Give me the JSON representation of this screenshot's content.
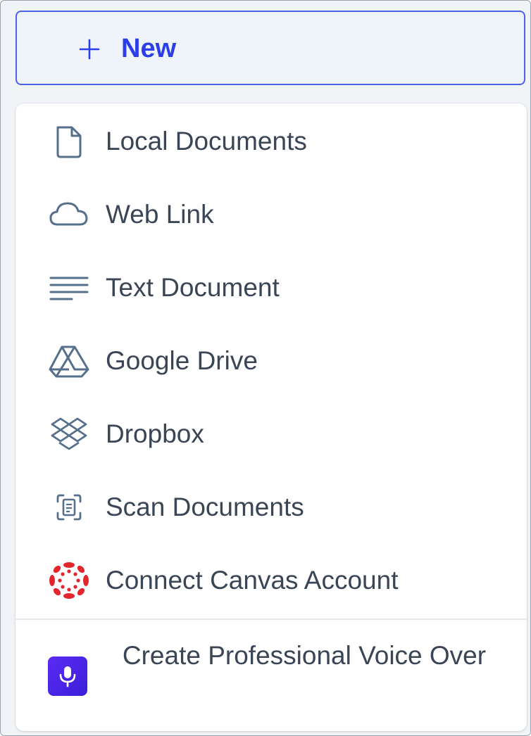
{
  "new_button": {
    "icon": "plus-icon",
    "label": "New",
    "accent_color": "#2b3ee8"
  },
  "menu": {
    "items": [
      {
        "icon": "document-icon",
        "label": "Local Documents"
      },
      {
        "icon": "cloud-icon",
        "label": "Web Link"
      },
      {
        "icon": "text-lines-icon",
        "label": "Text Document"
      },
      {
        "icon": "google-drive-icon",
        "label": "Google Drive"
      },
      {
        "icon": "dropbox-icon",
        "label": "Dropbox"
      },
      {
        "icon": "scan-icon",
        "label": "Scan Documents"
      },
      {
        "icon": "canvas-icon",
        "label": "Connect Canvas Account",
        "icon_color": "#e3262d"
      }
    ],
    "voice_over": {
      "icon": "microphone-icon",
      "label": "Create Professional Voice Over",
      "icon_color": "#4b25e8"
    }
  }
}
